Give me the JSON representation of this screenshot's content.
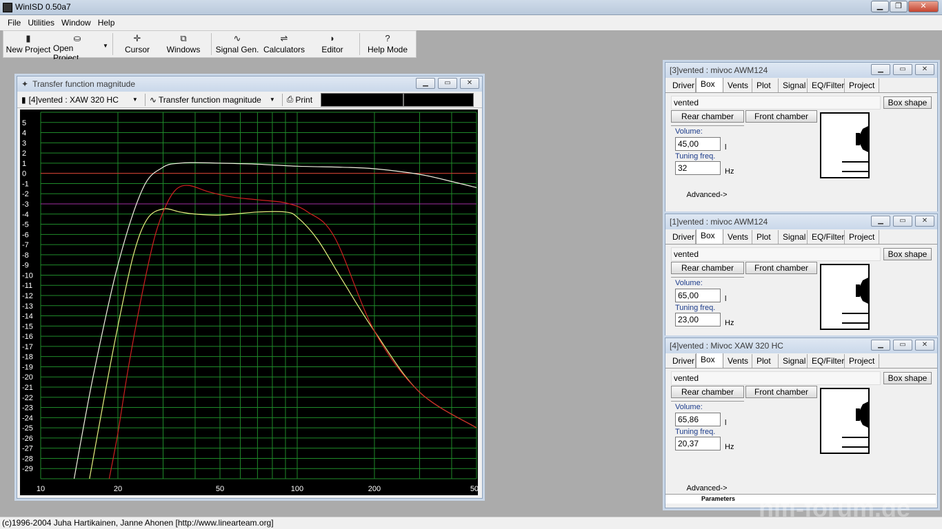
{
  "app": {
    "title": "WinISD 0.50a7",
    "min": "▁",
    "max": "❐",
    "close": "✕"
  },
  "menu": [
    "File",
    "Utilities",
    "Window",
    "Help"
  ],
  "toolbar": [
    {
      "label": "New Project",
      "icon": "new-project-icon"
    },
    {
      "label": "Open Project",
      "icon": "open-folder-icon"
    },
    {
      "label": "Cursor",
      "icon": "cursor-icon"
    },
    {
      "label": "Windows",
      "icon": "windows-icon"
    },
    {
      "label": "Signal Gen.",
      "icon": "signal-gen-icon"
    },
    {
      "label": "Calculators",
      "icon": "calculator-icon"
    },
    {
      "label": "Editor",
      "icon": "editor-icon"
    },
    {
      "label": "Help Mode",
      "icon": "help-icon"
    }
  ],
  "graph_window": {
    "title": "Transfer function magnitude",
    "project_select": "[4]vented : XAW 320 HC",
    "graph_select": "Transfer function magnitude",
    "print": "Print"
  },
  "chart_data": {
    "type": "line",
    "xscale": "log",
    "xlim": [
      10,
      500
    ],
    "ylim": [
      -30,
      6
    ],
    "x_ticks": [
      "10",
      "20",
      "50",
      "100",
      "200",
      "500"
    ],
    "y_ticks": [
      "5",
      "4",
      "3",
      "2",
      "1",
      "0",
      "-1",
      "-2",
      "-3",
      "-4",
      "-5",
      "-6",
      "-7",
      "-8",
      "-9",
      "-10",
      "-11",
      "-12",
      "-13",
      "-14",
      "-15",
      "-16",
      "-17",
      "-18",
      "-19",
      "-20",
      "-21",
      "-22",
      "-23",
      "-24",
      "-25",
      "-26",
      "-27",
      "-28",
      "-29"
    ],
    "reference_lines": [
      {
        "y": 0,
        "color": "#e03030"
      },
      {
        "y": -3,
        "color": "#a030a0"
      }
    ],
    "grid": true,
    "series": [
      {
        "color": "#f0f0e0",
        "x": [
          13.5,
          16,
          20,
          25,
          30,
          35,
          40,
          50,
          70,
          100,
          150,
          200,
          300,
          400,
          500
        ],
        "y": [
          -30,
          -20,
          -9,
          -1.5,
          0.6,
          1.0,
          1.05,
          1.0,
          0.9,
          0.7,
          0.6,
          0.45,
          -0.1,
          -0.8,
          -1.4
        ]
      },
      {
        "color": "#e8f080",
        "x": [
          15.5,
          18,
          20,
          23,
          26,
          30,
          35,
          40,
          50,
          70,
          90,
          100,
          120,
          150,
          200,
          300,
          500
        ],
        "y": [
          -30,
          -21,
          -15,
          -8,
          -4.5,
          -3.5,
          -3.8,
          -4.0,
          -4.1,
          -3.8,
          -3.8,
          -4.3,
          -6.5,
          -10.5,
          -15.5,
          -21.5,
          -25
        ]
      },
      {
        "color": "#d02020",
        "x": [
          18.5,
          20,
          22,
          25,
          28,
          31,
          34,
          38,
          45,
          55,
          70,
          90,
          110,
          140,
          200,
          300,
          500
        ],
        "y": [
          -30,
          -25.5,
          -19,
          -11.5,
          -6,
          -3,
          -1.5,
          -1.2,
          -1.8,
          -2.3,
          -2.6,
          -2.9,
          -3.8,
          -6.3,
          -15.5,
          -21.5,
          -25
        ]
      }
    ]
  },
  "panels": [
    {
      "title": "[3]vented : mivoc AWM124",
      "tabs": [
        "Driver",
        "Box",
        "Vents",
        "Plot",
        "Signal",
        "EQ/Filter",
        "Project"
      ],
      "active_tab": "Box",
      "box_type": "vented",
      "box_shape_btn": "Box shape",
      "rear_btn": "Rear chamber",
      "front_btn": "Front chamber",
      "volume_label": "Volume:",
      "volume": "45,00",
      "volume_unit": "l",
      "tuning_label": "Tuning freq.",
      "tuning": "32",
      "tuning_unit": "Hz",
      "advanced": "Advanced->"
    },
    {
      "title": "[1]vented : mivoc AWM124",
      "tabs": [
        "Driver",
        "Box",
        "Vents",
        "Plot",
        "Signal",
        "EQ/Filter",
        "Project"
      ],
      "active_tab": "Box",
      "box_type": "vented",
      "box_shape_btn": "Box shape",
      "rear_btn": "Rear chamber",
      "front_btn": "Front chamber",
      "volume_label": "Volume:",
      "volume": "65,00",
      "volume_unit": "l",
      "tuning_label": "Tuning freq.",
      "tuning": "23,00",
      "tuning_unit": "Hz",
      "advanced": ""
    },
    {
      "title": "[4]vented : Mivoc XAW 320 HC",
      "tabs": [
        "Driver",
        "Box",
        "Vents",
        "Plot",
        "Signal",
        "EQ/Filter",
        "Project"
      ],
      "active_tab": "Box",
      "box_type": "vented",
      "box_shape_btn": "Box shape",
      "rear_btn": "Rear chamber",
      "front_btn": "Front chamber",
      "volume_label": "Volume:",
      "volume": "65,86",
      "volume_unit": "l",
      "tuning_label": "Tuning freq.",
      "tuning": "20,37",
      "tuning_unit": "Hz",
      "advanced": "Advanced->",
      "footer": "Parameters"
    }
  ],
  "status": "(c)1996-2004 Juha Hartikainen, Janne Ahonen [http://www.linearteam.org]",
  "watermark": "hifi-forum.de"
}
